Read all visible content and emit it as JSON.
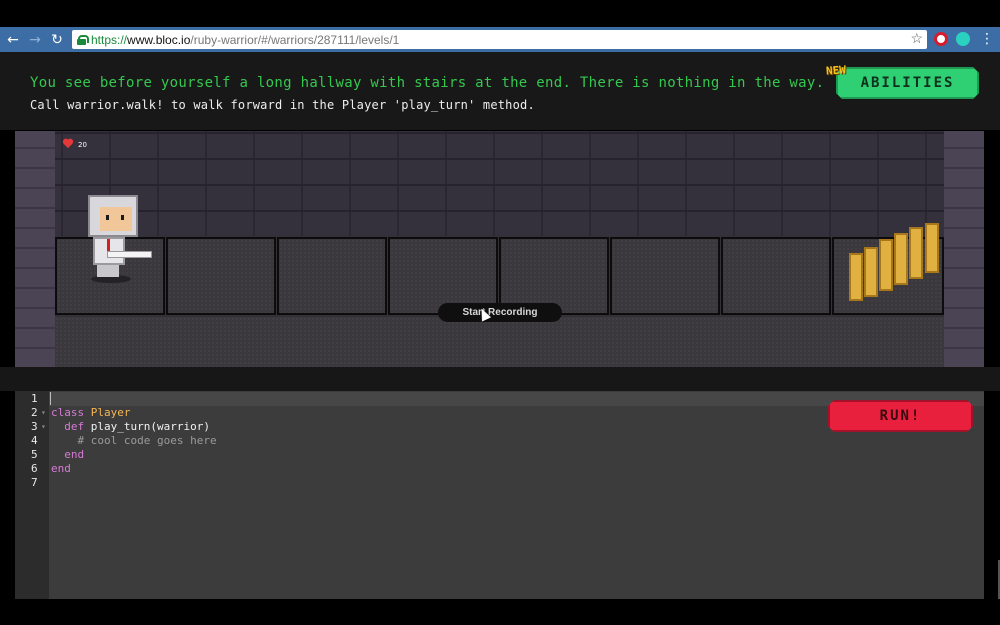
{
  "browser": {
    "url_scheme": "https://",
    "url_host": "www.bloc.io",
    "url_path": "/ruby-warrior/#/warriors/287111/levels/1",
    "back_icon": "←",
    "forward_icon": "→",
    "reload_icon": "↻",
    "star_icon": "☆",
    "menu_icon": "⋮"
  },
  "instructions": {
    "intro": "You see before yourself a long hallway with stairs at the end. There is nothing in the way.",
    "hint": "Call warrior.walk! to walk forward in the Player 'play_turn' method."
  },
  "abilities": {
    "badge": "NEW",
    "label": "ABILITIES",
    "color": "#2fcf73"
  },
  "game": {
    "health_value": "20",
    "record_label": "Start Recording"
  },
  "editor": {
    "lines": [
      {
        "num": "1",
        "indent": "",
        "parts": []
      },
      {
        "num": "2",
        "indent": "",
        "parts": [
          {
            "cls": "kw",
            "t": "class "
          },
          {
            "cls": "cls",
            "t": "Player"
          }
        ]
      },
      {
        "num": "3",
        "indent": "  ",
        "parts": [
          {
            "cls": "kw",
            "t": "def "
          },
          {
            "cls": "txt",
            "t": "play_turn(warrior)"
          }
        ]
      },
      {
        "num": "4",
        "indent": "    ",
        "parts": [
          {
            "cls": "cmt",
            "t": "# cool code goes here"
          }
        ]
      },
      {
        "num": "5",
        "indent": "  ",
        "parts": [
          {
            "cls": "kw",
            "t": "end"
          }
        ]
      },
      {
        "num": "6",
        "indent": "",
        "parts": [
          {
            "cls": "kw",
            "t": "end"
          }
        ]
      },
      {
        "num": "7",
        "indent": "",
        "parts": []
      }
    ],
    "run_label": "RUN!",
    "run_color": "#e8203e"
  }
}
